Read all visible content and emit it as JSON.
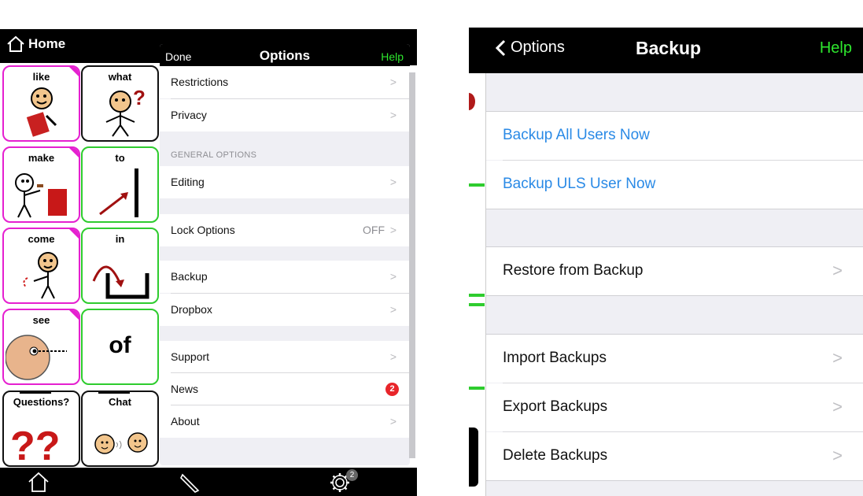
{
  "left": {
    "home_title": "Home",
    "grid": [
      {
        "label": "like",
        "kind": "pink"
      },
      {
        "label": "what",
        "kind": "black"
      },
      {
        "label": "make",
        "kind": "pink"
      },
      {
        "label": "to",
        "kind": "green"
      },
      {
        "label": "come",
        "kind": "pink"
      },
      {
        "label": "in",
        "kind": "green"
      },
      {
        "label": "see",
        "kind": "pink"
      },
      {
        "label": "of",
        "kind": "green"
      },
      {
        "label": "Questions?",
        "kind": "black"
      },
      {
        "label": "Chat",
        "kind": "black"
      }
    ],
    "options": {
      "done": "Done",
      "title": "Options",
      "help": "Help",
      "rows": {
        "restrictions": "Restrictions",
        "privacy": "Privacy",
        "general_section": "GENERAL OPTIONS",
        "editing": "Editing",
        "lock_options": "Lock Options",
        "lock_value": "OFF",
        "backup": "Backup",
        "dropbox": "Dropbox",
        "support": "Support",
        "news": "News",
        "news_badge": "2",
        "about": "About"
      }
    },
    "bottombar": {
      "icons": [
        "home-icon",
        "pencil-icon",
        "gear-icon"
      ],
      "gear_badge": "2"
    }
  },
  "right": {
    "nav": {
      "back_label": "Options",
      "title": "Backup",
      "help": "Help"
    },
    "rows": {
      "backup_all": "Backup All Users Now",
      "backup_uls": "Backup ULS User Now",
      "restore": "Restore from Backup",
      "import": "Import Backups",
      "export": "Export Backups",
      "delete": "Delete Backups"
    }
  },
  "colors": {
    "help_green": "#2ee62e",
    "link_blue": "#2a8ae6",
    "badge_red": "#e8252a",
    "pink_border": "#e520d0",
    "green_border": "#2ecc2e"
  }
}
